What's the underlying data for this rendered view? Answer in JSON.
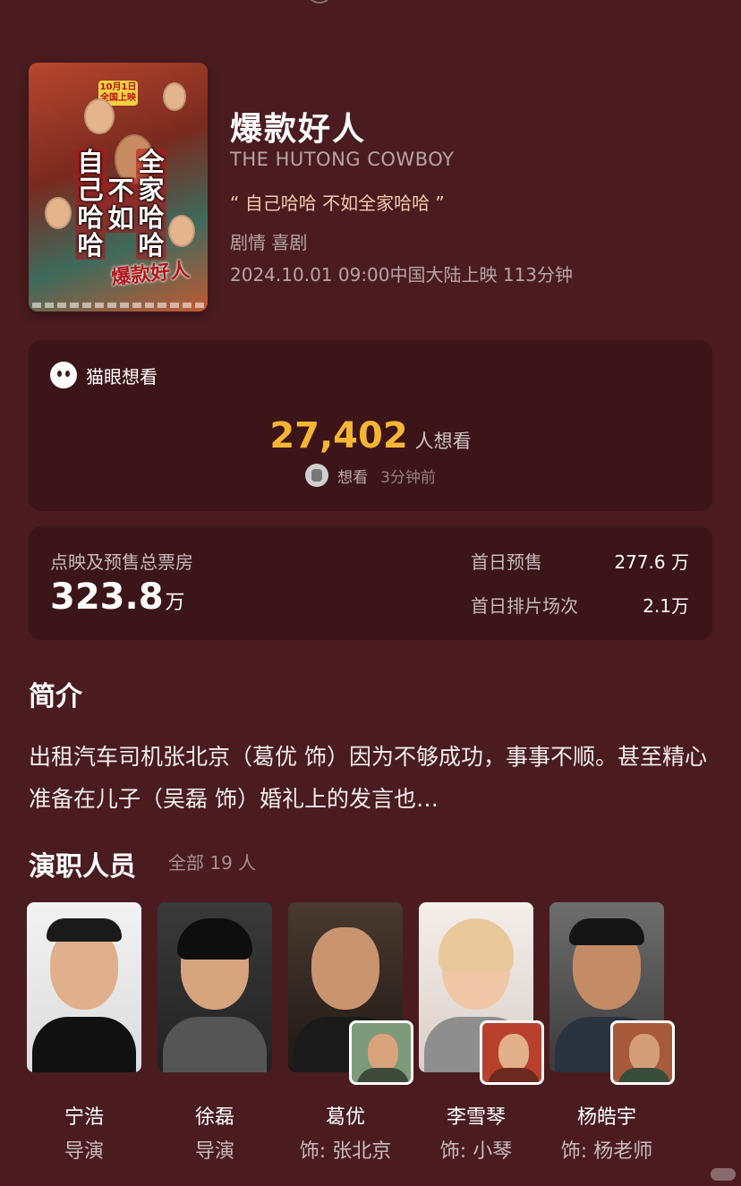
{
  "movie": {
    "title": "爆款好人",
    "en_title": "THE HUTONG COWBOY",
    "tagline": "“ 自己哈哈 不如全家哈哈 ”",
    "genre": "剧情 喜剧",
    "release": "2024.10.01 09:00中国大陆上映 113分钟",
    "poster": {
      "date_badge": "10月1日 全国上映",
      "text_left": "自己哈哈",
      "text_mid": "不如",
      "text_right": "全家哈哈",
      "logo_text": "爆款好人"
    }
  },
  "want": {
    "header": "猫眼想看",
    "count": "27,402",
    "unit": "人想看",
    "recent_label": "想看",
    "recent_time": "3分钟前",
    "icon": "cat-icon"
  },
  "box_office": {
    "label": "点映及预售总票房",
    "value": "323.8",
    "unit": "万",
    "first_day_presale_label": "首日预售",
    "first_day_presale_value": "277.6 万",
    "first_day_shows_label": "首日排片场次",
    "first_day_shows_value": "2.1万"
  },
  "intro": {
    "title": "简介",
    "text": "出租汽车司机张北京（葛优 饰）因为不够成功，事事不顺。甚至精心准备在儿子（吴磊 饰）婚礼上的发言也…"
  },
  "cast": {
    "title": "演职人员",
    "all_label": "全部 19 人",
    "members": [
      {
        "name": "宁浩",
        "role": "导演"
      },
      {
        "name": "徐磊",
        "role": "导演"
      },
      {
        "name": "葛优",
        "role": "饰: 张北京"
      },
      {
        "name": "李雪琴",
        "role": "饰: 小琴"
      },
      {
        "name": "杨皓宇",
        "role": "饰: 杨老师"
      }
    ]
  },
  "colors": {
    "background": "#4a1c1f",
    "card": "#3c1518",
    "accent": "#f6b634"
  }
}
